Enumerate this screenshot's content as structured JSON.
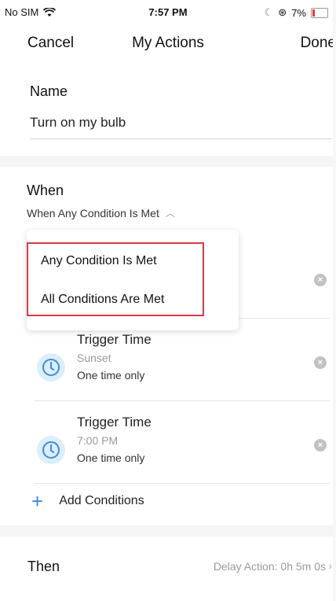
{
  "status_bar": {
    "carrier": "No SIM",
    "time": "7:57 PM",
    "battery": "7%",
    "icons": [
      "wifi-icon",
      "orientation-lock-icon",
      "battery-icon"
    ],
    "battery_color": "#e53935"
  },
  "nav": {
    "cancel_label": "Cancel",
    "title": "My Actions",
    "done_label": "Done"
  },
  "name_section": {
    "label": "Name",
    "value": "Turn on my bulb"
  },
  "when_section": {
    "label": "When",
    "selector_label": "When Any Condition Is Met"
  },
  "dropdown": {
    "options": [
      "Any Condition Is Met",
      "All Conditions Are Met"
    ],
    "highlight_color": "#d43b4a"
  },
  "conditions": [
    {
      "title": "",
      "detail": "",
      "frequency": ""
    },
    {
      "title": "Trigger Time",
      "detail": "Sunset",
      "frequency": "One time only"
    },
    {
      "title": "Trigger Time",
      "detail": "7:00 PM",
      "frequency": "One time only"
    }
  ],
  "add_conditions_label": "Add Conditions",
  "then_section": {
    "label": "Then",
    "delay_label": "Delay Action: 0h 5m 0s"
  },
  "accent_color": "#3a8dd8"
}
